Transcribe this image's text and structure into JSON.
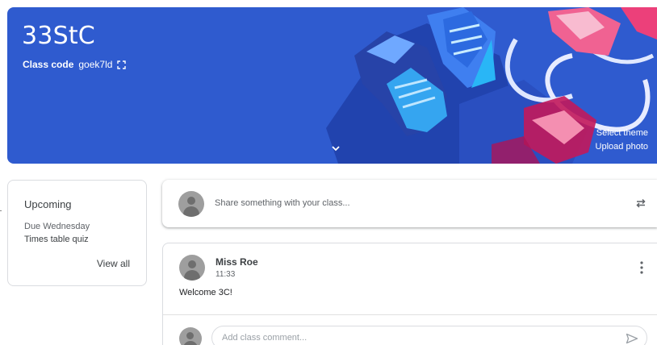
{
  "banner": {
    "class_title": "33StC",
    "class_code_label": "Class code",
    "class_code_value": "goek7ld",
    "select_theme": "Select theme",
    "upload_photo": "Upload photo",
    "colors": {
      "background": "#2f5bcf",
      "text": "#ffffff"
    }
  },
  "upcoming": {
    "title": "Upcoming",
    "due": "Due Wednesday",
    "item": "Times table quiz",
    "view_all": "View all"
  },
  "share": {
    "placeholder": "Share something with your class...",
    "icon": "repost-icon"
  },
  "post": {
    "author": "Miss Roe",
    "time": "11:33",
    "body": "Welcome 3C!",
    "comment_placeholder": "Add class comment...",
    "menu_icon": "more-vert-icon",
    "send_icon": "send-icon"
  }
}
